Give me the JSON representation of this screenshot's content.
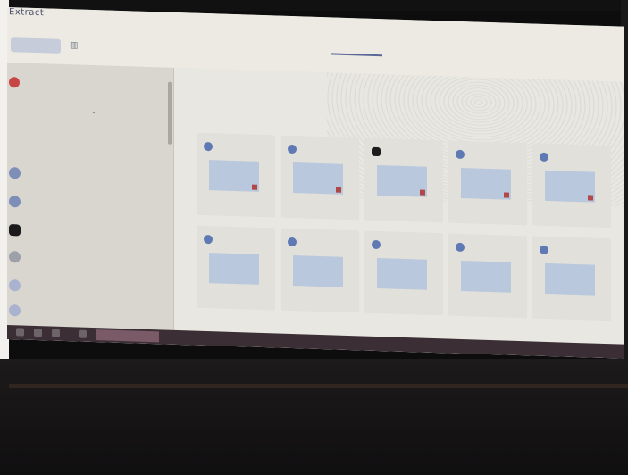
{
  "app": {
    "title": "Extract",
    "new_button": "",
    "view_dropdown": "",
    "tabs": [
      {
        "label": "",
        "active": false
      },
      {
        "label": "",
        "active": true
      }
    ]
  },
  "sidebar": {
    "header": "",
    "filter": "",
    "section": "",
    "items": [
      {
        "name": "",
        "meta": "",
        "avatar": "blue"
      },
      {
        "name": "",
        "meta": "",
        "avatar": "blue"
      },
      {
        "name": "",
        "meta": "",
        "avatar": "black"
      },
      {
        "name": "",
        "meta": "",
        "avatar": "grey"
      },
      {
        "name": "",
        "meta": "",
        "avatar": "pale"
      },
      {
        "name": "",
        "meta": "",
        "avatar": "pale"
      }
    ]
  },
  "main": {
    "breadcrumbs": [
      "",
      "",
      "",
      "",
      ""
    ],
    "cards": [
      {
        "label": "",
        "caption": "",
        "icon": "blue"
      },
      {
        "label": "",
        "caption": "",
        "icon": "blue"
      },
      {
        "label": "",
        "caption": "",
        "icon": "black"
      },
      {
        "label": "",
        "caption": "",
        "icon": "blue"
      },
      {
        "label": "",
        "caption": "",
        "icon": "blue"
      },
      {
        "label": "",
        "caption": "",
        "icon": "blue"
      },
      {
        "label": "",
        "caption": "",
        "icon": "blue"
      },
      {
        "label": "",
        "caption": "",
        "icon": "blue"
      },
      {
        "label": "",
        "caption": "",
        "icon": "blue"
      },
      {
        "label": "",
        "caption": "",
        "icon": "blue"
      }
    ],
    "footer": [
      "",
      "",
      "",
      "",
      ""
    ]
  },
  "taskbar": {
    "active_window": "",
    "tray": ""
  },
  "colors": {
    "accent": "#5b6796",
    "badge": "#b04848",
    "taskbar": "#3b2f35"
  }
}
